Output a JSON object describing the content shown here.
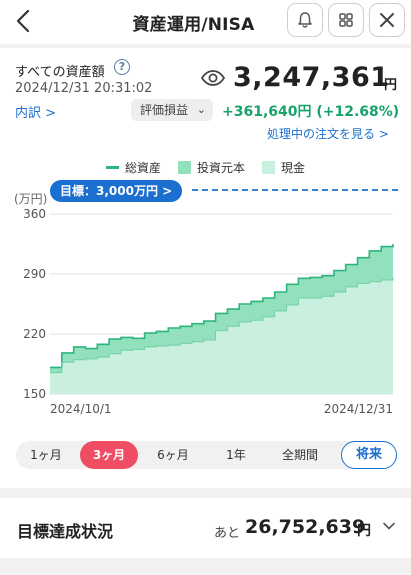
{
  "header": {
    "title": "資産運用/NISA"
  },
  "summary": {
    "label": "すべての資産額",
    "help": "?",
    "timestamp": "2024/12/31 20:31:02",
    "amount": "3,247,361",
    "unit": "円",
    "breakdown_link": "内訳 >",
    "pl_select": "評価損益",
    "pl_value": "+361,640円 (+12.68%)",
    "orders_link": "処理中の注文を見る >"
  },
  "legend": {
    "total": "総資産",
    "invested": "投資元本",
    "cash": "現金"
  },
  "colors": {
    "total": "#2db57f",
    "invested": "#92e0bc",
    "cash": "#c9f0de",
    "goal": "#1b6fcf",
    "active_tab": "#ee4d63"
  },
  "chart_data": {
    "type": "area",
    "unit_label": "(万円)",
    "goal_label": "目標：3,000万円 >",
    "ylim": [
      150,
      360
    ],
    "yticks": [
      150,
      220,
      290,
      360
    ],
    "x_labels": [
      "2024/10/1",
      "2024/12/31"
    ],
    "goal_value": 3000,
    "series": [
      {
        "name": "総資産",
        "values": [
          181,
          198,
          205,
          203,
          208,
          214,
          216,
          215,
          221,
          223,
          227,
          229,
          232,
          235,
          244,
          249,
          255,
          258,
          262,
          269,
          278,
          285,
          286,
          288,
          294,
          301,
          309,
          317,
          322,
          325
        ]
      },
      {
        "name": "投資元本",
        "values": [
          175,
          187,
          190,
          191,
          193,
          197,
          201,
          202,
          205,
          206,
          207,
          209,
          211,
          213,
          224,
          229,
          234,
          236,
          240,
          247,
          254,
          262,
          262,
          264,
          269,
          275,
          279,
          281,
          283,
          286
        ]
      }
    ]
  },
  "tabs": [
    "1ヶ月",
    "3ヶ月",
    "6ヶ月",
    "1年",
    "全期間"
  ],
  "future_button": "将来",
  "goal_status": {
    "title": "目標達成状況",
    "prefix": "あと",
    "value": "26,752,639",
    "unit": "円"
  }
}
